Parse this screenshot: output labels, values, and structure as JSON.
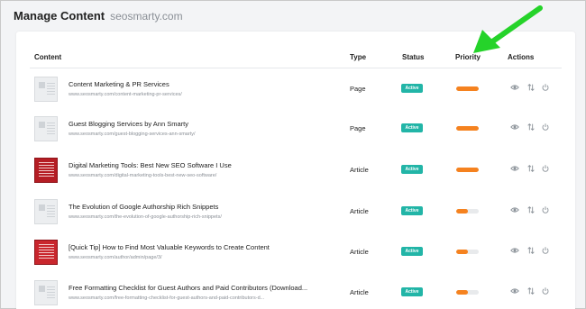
{
  "header": {
    "title": "Manage Content",
    "domain": "seosmarty.com"
  },
  "table": {
    "columns": {
      "content": "Content",
      "type": "Type",
      "status": "Status",
      "priority": "Priority",
      "actions": "Actions"
    },
    "rows": [
      {
        "title": "Content Marketing & PR Services",
        "url": "www.seosmarty.com/content-marketing-pr-services/",
        "type": "Page",
        "status": "Active",
        "priority": 1.0,
        "thumbnail": "document-placeholder-icon"
      },
      {
        "title": "Guest Blogging Services by Ann Smarty",
        "url": "www.seosmarty.com/guest-blogging-services-ann-smarty/",
        "type": "Page",
        "status": "Active",
        "priority": 1.0,
        "thumbnail": "document-placeholder-icon"
      },
      {
        "title": "Digital Marketing Tools: Best New SEO Software I Use",
        "url": "www.seosmarty.com/digital-marketing-tools-best-new-seo-software/",
        "type": "Article",
        "status": "Active",
        "priority": 1.0,
        "thumbnail": "book-cover-image"
      },
      {
        "title": "The Evolution of Google Authorship Rich Snippets",
        "url": "www.seosmarty.com/the-evolution-of-google-authorship-rich-snippets/",
        "type": "Article",
        "status": "Active",
        "priority": 0.5,
        "thumbnail": "document-placeholder-icon"
      },
      {
        "title": "[Quick Tip] How to Find Most Valuable Keywords to Create Content",
        "url": "www.seosmarty.com/author/admin/page/3/",
        "type": "Article",
        "status": "Active",
        "priority": 0.5,
        "thumbnail": "book-cover-image"
      },
      {
        "title": "Free Formatting Checklist for Guest Authors and Paid Contributors (Download...",
        "url": "www.seosmarty.com/free-formatting-checklist-for-guest-authors-and-paid-contributors-d...",
        "type": "Article",
        "status": "Active",
        "priority": 0.5,
        "thumbnail": "document-placeholder-icon"
      }
    ]
  },
  "colors": {
    "accent_badge": "#22b5a7",
    "priority_bar": "#f5821f",
    "annotation_arrow": "#25d32a"
  },
  "icons": {
    "view": "eye-icon",
    "reorder": "sort-arrows-icon",
    "toggle": "power-icon"
  }
}
